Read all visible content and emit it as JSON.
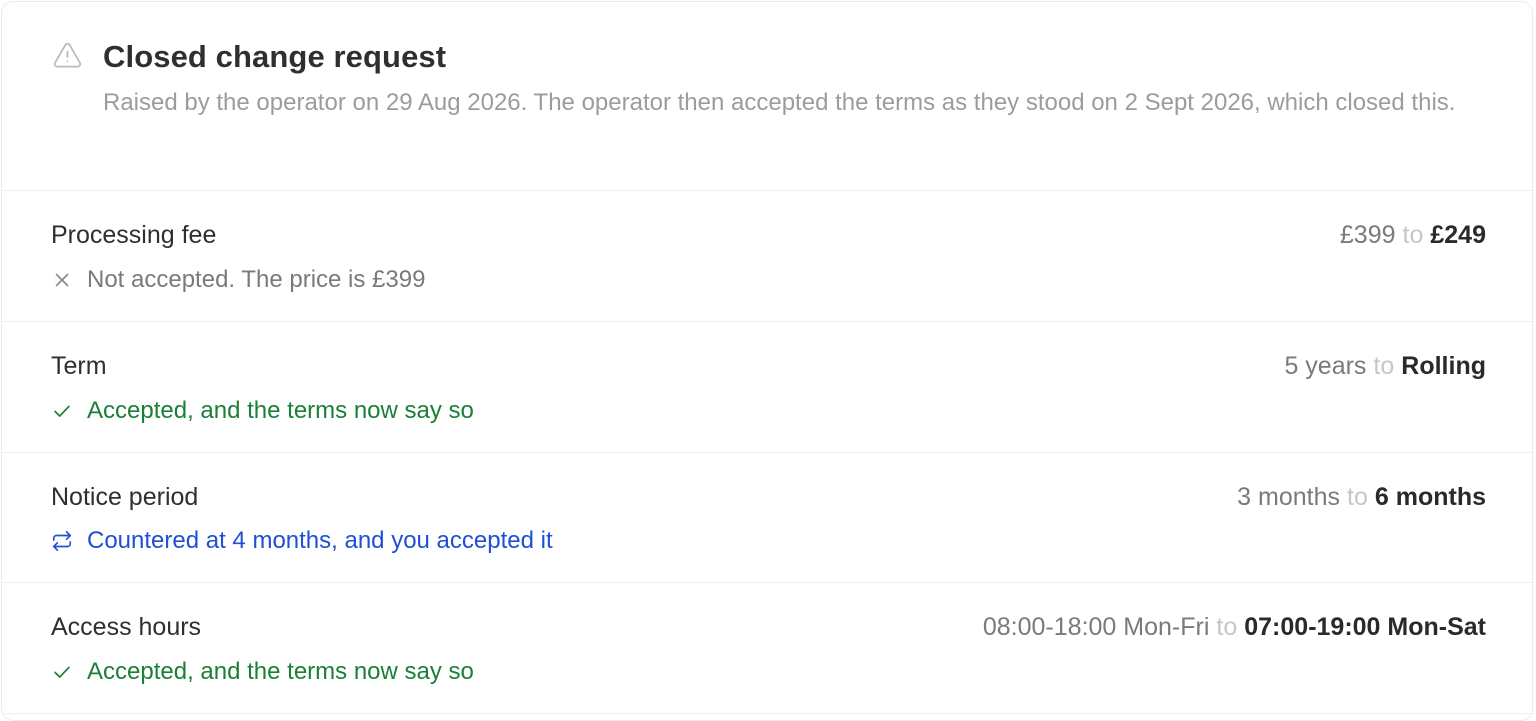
{
  "header": {
    "icon": "warning-triangle-icon",
    "title": "Closed change request",
    "description": "Raised by the operator on 29 Aug 2026. The operator then accepted the terms as they stood on 2 Sept 2026, which closed this."
  },
  "to_word": "to",
  "rows": [
    {
      "label": "Processing fee",
      "from": "£399",
      "to": "£249",
      "status_type": "rejected",
      "status_icon": "x-icon",
      "status_text": "Not accepted. The price is £399"
    },
    {
      "label": "Term",
      "from": "5 years",
      "to": "Rolling",
      "status_type": "accepted",
      "status_icon": "check-icon",
      "status_text": "Accepted, and the terms now say so"
    },
    {
      "label": "Notice period",
      "from": "3 months",
      "to": "6 months",
      "status_type": "countered",
      "status_icon": "repeat-arrows-icon",
      "status_text": "Countered at 4 months, and you accepted it"
    },
    {
      "label": "Access hours",
      "from": "08:00-18:00 Mon-Fri",
      "to": "07:00-19:00 Mon-Sat",
      "status_type": "accepted",
      "status_icon": "check-icon",
      "status_text": "Accepted, and the terms now say so"
    }
  ],
  "colors": {
    "accepted": "#1a7f37",
    "countered": "#1f4fd6",
    "rejected": "#7a7a7a",
    "muted_text": "#9c9c9c"
  }
}
